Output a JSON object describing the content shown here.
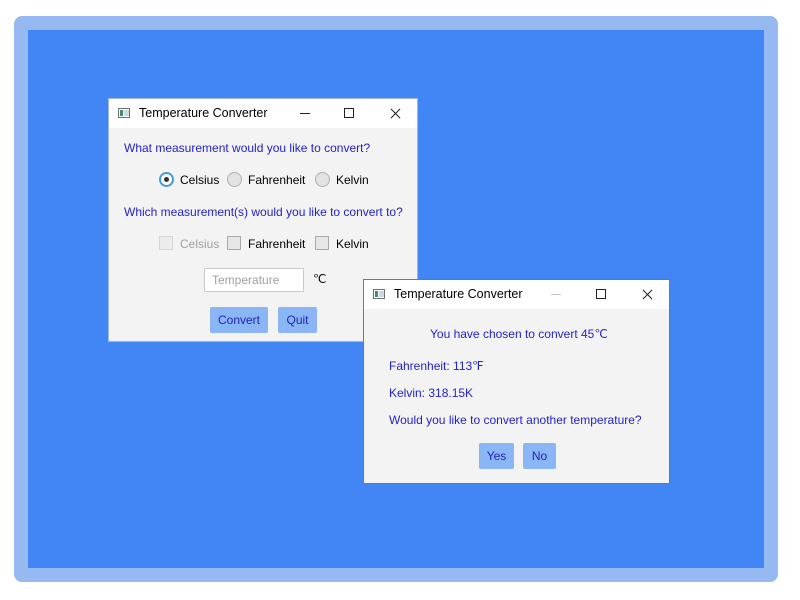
{
  "main_window": {
    "title": "Temperature Converter",
    "question_from": "What measurement would you like to convert?",
    "from_options": [
      {
        "label": "Celsius",
        "checked": true
      },
      {
        "label": "Fahrenheit",
        "checked": false
      },
      {
        "label": "Kelvin",
        "checked": false
      }
    ],
    "question_to": "Which measurement(s) would you like to convert to?",
    "to_options": [
      {
        "label": "Celsius",
        "checked": false,
        "disabled": true
      },
      {
        "label": "Fahrenheit",
        "checked": false,
        "disabled": false
      },
      {
        "label": "Kelvin",
        "checked": false,
        "disabled": false
      }
    ],
    "temperature_input": {
      "value": "",
      "placeholder": "Temperature"
    },
    "unit_symbol": "℃",
    "convert_label": "Convert",
    "quit_label": "Quit"
  },
  "result_dialog": {
    "title": "Temperature Converter",
    "heading": "You have chosen to convert 45℃",
    "fahrenheit_result": "Fahrenheit: 113℉",
    "kelvin_result": "Kelvin: 318.15K",
    "prompt": "Would you like to convert another temperature?",
    "yes_label": "Yes",
    "no_label": "No"
  },
  "colors": {
    "desktop": "#4285f4",
    "frame": "#95b9f0",
    "window_bg": "#f3f3f3",
    "text_blue": "#2222cc",
    "button_bg": "#8ab6f5"
  }
}
